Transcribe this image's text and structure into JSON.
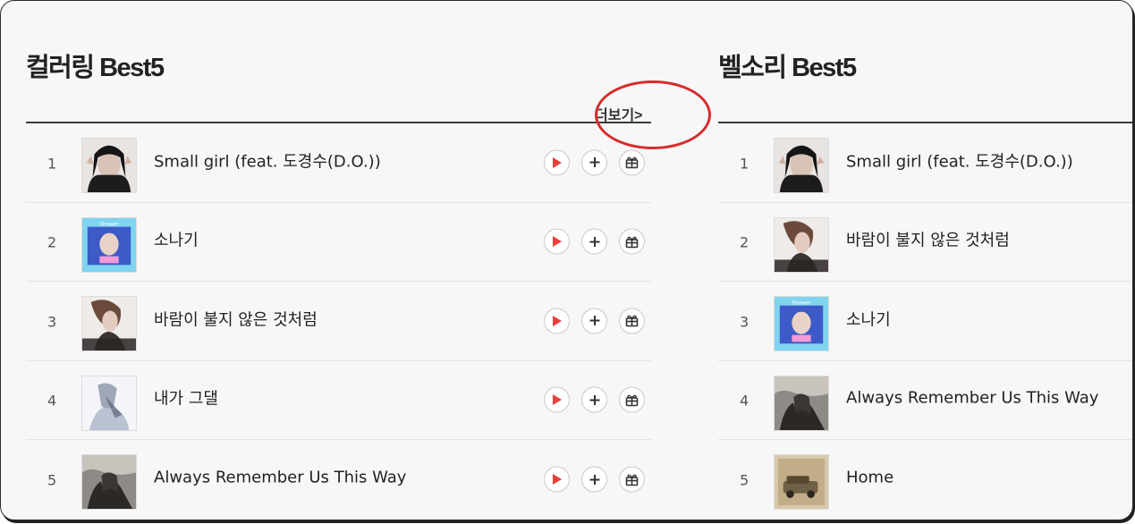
{
  "coloring": {
    "title": "컬러링 Best5",
    "more_label": "더보기>",
    "songs": [
      {
        "rank": "1",
        "title": "Small girl (feat. 도경수(D.O.))"
      },
      {
        "rank": "2",
        "title": "소나기"
      },
      {
        "rank": "3",
        "title": "바람이 불지 않은 것처럼"
      },
      {
        "rank": "4",
        "title": "내가 그댈"
      },
      {
        "rank": "5",
        "title": "Always Remember Us This Way"
      }
    ]
  },
  "bell": {
    "title": "벨소리 Best5",
    "songs": [
      {
        "rank": "1",
        "title": "Small girl (feat. 도경수(D.O.))"
      },
      {
        "rank": "2",
        "title": "바람이 불지 않은 것처럼"
      },
      {
        "rank": "3",
        "title": "소나기"
      },
      {
        "rank": "4",
        "title": "Always Remember Us This Way"
      },
      {
        "rank": "5",
        "title": "Home"
      }
    ]
  },
  "icons": {
    "play": "play-icon",
    "add": "plus-icon",
    "gift": "gift-icon"
  },
  "colors": {
    "accent_red": "#e8403a",
    "highlight_circle": "#d62b2b",
    "background": "#f7f7f7"
  }
}
